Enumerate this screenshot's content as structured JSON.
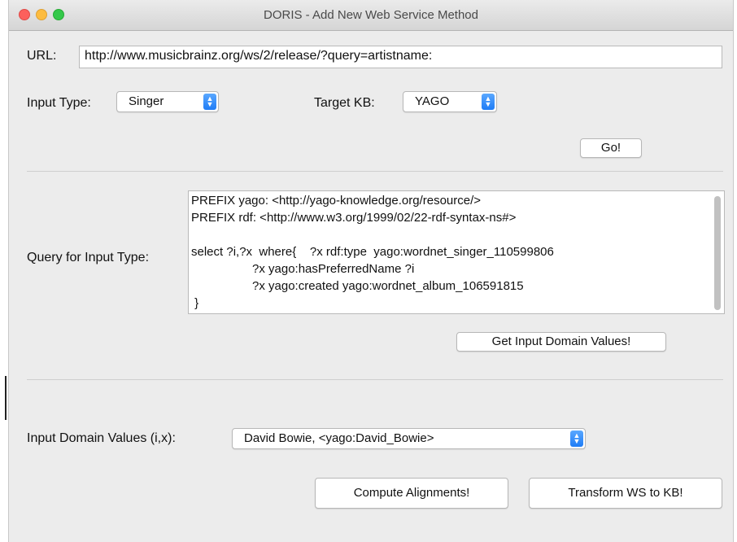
{
  "window": {
    "title": "DORIS - Add New Web Service Method"
  },
  "url": {
    "label": "URL:",
    "value": "http://www.musicbrainz.org/ws/2/release/?query=artistname:"
  },
  "input_type": {
    "label": "Input Type:",
    "selected": "Singer"
  },
  "target_kb": {
    "label": "Target KB:",
    "selected": "YAGO"
  },
  "go_button": {
    "label": "Go!"
  },
  "query": {
    "label": "Query for Input Type:",
    "lines": [
      "PREFIX yago: <http://yago-knowledge.org/resource/>",
      "PREFIX rdf: <http://www.w3.org/1999/02/22-rdf-syntax-ns#>",
      "",
      "select ?i,?x  where{    ?x rdf:type  yago:wordnet_singer_110599806",
      "                  ?x yago:hasPreferredName ?i",
      "                  ?x yago:created yago:wordnet_album_106591815",
      " }"
    ]
  },
  "get_domain_button": {
    "label": "Get Input Domain Values!"
  },
  "domain_values": {
    "label": "Input Domain Values (i,x):",
    "selected": "David Bowie, <yago:David_Bowie>"
  },
  "compute_button": {
    "label": "Compute Alignments!"
  },
  "transform_button": {
    "label": "Transform WS to KB!"
  },
  "colors": {
    "accent": "#1e7cf6",
    "close": "#fc605c",
    "minimize": "#fdbc40",
    "maximize": "#34c84a"
  }
}
